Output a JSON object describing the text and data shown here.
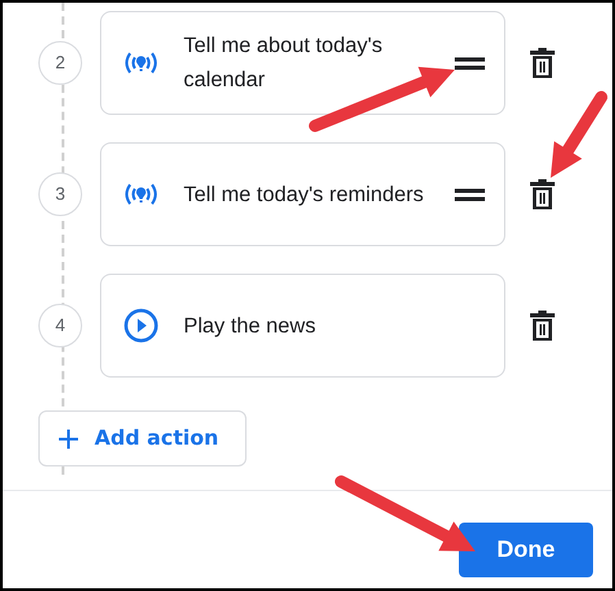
{
  "steps": [
    {
      "number": "2",
      "kind": "broadcast",
      "label": "Tell me about today's calendar",
      "draggable": true
    },
    {
      "number": "3",
      "kind": "broadcast",
      "label": "Tell me today's reminders",
      "draggable": true
    },
    {
      "number": "4",
      "kind": "play",
      "label": "Play the news",
      "draggable": false
    }
  ],
  "add_button": {
    "label": "Add action"
  },
  "done_button": {
    "label": "Done"
  },
  "annotations": [
    {
      "kind": "arrow"
    },
    {
      "kind": "arrow"
    },
    {
      "kind": "arrow"
    }
  ]
}
